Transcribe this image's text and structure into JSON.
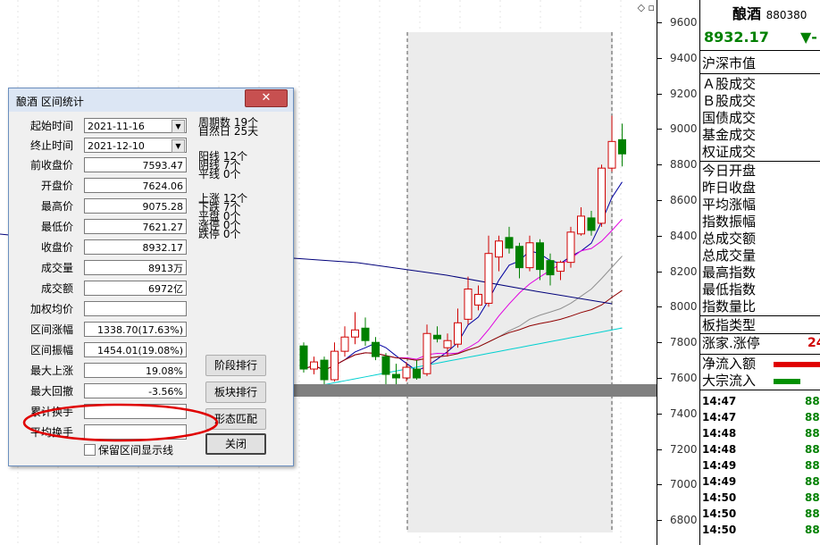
{
  "axis": {
    "ticks": [
      "9600",
      "9400",
      "9200",
      "9000",
      "8800",
      "8600",
      "8400",
      "8200",
      "8000",
      "7800",
      "7600",
      "7400",
      "7200",
      "7000",
      "6800"
    ]
  },
  "panel": {
    "name": "酿酒",
    "code": "880380",
    "price": "8932.17",
    "change_mark": "▼-",
    "labels": [
      "沪深市值",
      "Ａ股成交",
      "Ｂ股成交",
      "国债成交",
      "基金成交",
      "权证成交",
      "今日开盘",
      "昨日收盘",
      "平均涨幅",
      "指数振幅",
      "总成交额",
      "总成交量",
      "最高指数",
      "最低指数",
      "指数量比",
      "板指类型",
      "涨家.涨停",
      "净流入额",
      "大宗流入"
    ],
    "up_count": "24",
    "ticks": [
      {
        "time": "14:47",
        "value": "88"
      },
      {
        "time": "14:47",
        "value": "88"
      },
      {
        "time": "14:48",
        "value": "88"
      },
      {
        "time": "14:48",
        "value": "88"
      },
      {
        "time": "14:49",
        "value": "88"
      },
      {
        "time": "14:49",
        "value": "88"
      },
      {
        "time": "14:50",
        "value": "88"
      },
      {
        "time": "14:50",
        "value": "88"
      },
      {
        "time": "14:50",
        "value": "88"
      }
    ]
  },
  "dialog": {
    "title": "酿酒 区间统计",
    "close": "✕",
    "start_label": "起始时间",
    "start_value": "2021-11-16",
    "end_label": "终止时间",
    "end_value": "2021-12-10",
    "rows": [
      {
        "label": "前收盘价",
        "value": "7593.47"
      },
      {
        "label": "开盘价",
        "value": "7624.06"
      },
      {
        "label": "最高价",
        "value": "9075.28"
      },
      {
        "label": "最低价",
        "value": "7621.27"
      },
      {
        "label": "收盘价",
        "value": "8932.17"
      },
      {
        "label": "成交量",
        "value": "8913万"
      },
      {
        "label": "成交额",
        "value": "6972亿"
      },
      {
        "label": "加权均价",
        "value": ""
      },
      {
        "label": "区间涨幅",
        "value": "1338.70(17.63%)"
      },
      {
        "label": "区间振幅",
        "value": "1454.01(19.08%)"
      },
      {
        "label": "最大上涨",
        "value": "19.08%"
      },
      {
        "label": "最大回撤",
        "value": "-3.56%"
      },
      {
        "label": "累计换手",
        "value": ""
      },
      {
        "label": "平均换手",
        "value": ""
      }
    ],
    "period_lines": [
      "周期数 19个",
      "自然日 25天"
    ],
    "kline_lines": [
      "阳线 12个",
      "阴线 7个",
      "平线 0个"
    ],
    "updown_lines": [
      "上涨 12个",
      "下跌 7个",
      "平盘 0个",
      "涨停 0个",
      "跌停 0个"
    ],
    "buttons": [
      "阶段排行",
      "板块排行",
      "形态匹配",
      "关闭"
    ],
    "keep_label": "保留区间显示线"
  },
  "chart_data": {
    "type": "candlestick",
    "ylim": [
      6700,
      9700
    ],
    "candles": [
      {
        "o": 7780,
        "c": 7650,
        "h": 7800,
        "l": 7630
      },
      {
        "o": 7650,
        "c": 7690,
        "h": 7720,
        "l": 7620
      },
      {
        "o": 7700,
        "c": 7590,
        "h": 7720,
        "l": 7560
      },
      {
        "o": 7590,
        "c": 7750,
        "h": 7800,
        "l": 7580
      },
      {
        "o": 7750,
        "c": 7830,
        "h": 7890,
        "l": 7720
      },
      {
        "o": 7830,
        "c": 7870,
        "h": 7970,
        "l": 7790
      },
      {
        "o": 7880,
        "c": 7810,
        "h": 7940,
        "l": 7780
      },
      {
        "o": 7800,
        "c": 7720,
        "h": 7830,
        "l": 7700
      },
      {
        "o": 7720,
        "c": 7620,
        "h": 7740,
        "l": 7560
      },
      {
        "o": 7620,
        "c": 7600,
        "h": 7680,
        "l": 7560
      },
      {
        "o": 7600,
        "c": 7660,
        "h": 7690,
        "l": 7580
      },
      {
        "o": 7650,
        "c": 7600,
        "h": 7700,
        "l": 7590
      },
      {
        "o": 7624,
        "c": 7850,
        "h": 7900,
        "l": 7610
      },
      {
        "o": 7840,
        "c": 7820,
        "h": 7890,
        "l": 7800
      },
      {
        "o": 7770,
        "c": 7810,
        "h": 7850,
        "l": 7720
      },
      {
        "o": 7790,
        "c": 7910,
        "h": 7990,
        "l": 7770
      },
      {
        "o": 7930,
        "c": 8100,
        "h": 8170,
        "l": 7900
      },
      {
        "o": 8010,
        "c": 8070,
        "h": 8120,
        "l": 7980
      },
      {
        "o": 8020,
        "c": 8300,
        "h": 8400,
        "l": 8000
      },
      {
        "o": 8280,
        "c": 8370,
        "h": 8400,
        "l": 8200
      },
      {
        "o": 8390,
        "c": 8330,
        "h": 8450,
        "l": 8300
      },
      {
        "o": 8340,
        "c": 8220,
        "h": 8360,
        "l": 8160
      },
      {
        "o": 8220,
        "c": 8360,
        "h": 8400,
        "l": 8200
      },
      {
        "o": 8360,
        "c": 8210,
        "h": 8380,
        "l": 8150
      },
      {
        "o": 8260,
        "c": 8180,
        "h": 8300,
        "l": 8120
      },
      {
        "o": 8200,
        "c": 8250,
        "h": 8260,
        "l": 8150
      },
      {
        "o": 8250,
        "c": 8420,
        "h": 8450,
        "l": 8220
      },
      {
        "o": 8410,
        "c": 8510,
        "h": 8560,
        "l": 8400
      },
      {
        "o": 8500,
        "c": 8430,
        "h": 8540,
        "l": 8400
      },
      {
        "o": 8470,
        "c": 8780,
        "h": 8800,
        "l": 8450
      },
      {
        "o": 8780,
        "c": 8930,
        "h": 9075,
        "l": 8760
      },
      {
        "o": 8940,
        "c": 8860,
        "h": 9030,
        "l": 8790
      }
    ],
    "interval": {
      "start_index": 12,
      "end_index": 30
    }
  }
}
